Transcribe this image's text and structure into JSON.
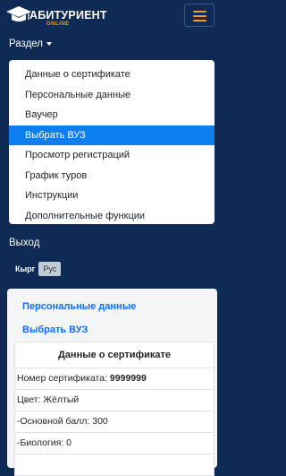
{
  "header": {
    "logo_text": "АБИТУРИЕНТ",
    "logo_sub": "ONLINE"
  },
  "nav": {
    "section_label": "Раздел",
    "menu_items": [
      "Данные о сертификате",
      "Персональные данные",
      "Ваучер",
      "Выбрать ВУЗ",
      "Просмотр регистраций",
      "График туров",
      "Инструкции",
      "Дополнительные функции"
    ],
    "active_item": "Выбрать ВУЗ",
    "logout_label": "Выход",
    "languages": [
      "Кырг",
      "Рус"
    ],
    "selected_language": "Рус"
  },
  "content": {
    "links": [
      "Персональные данные",
      "Выбрать ВУЗ"
    ],
    "card_title": "Данные о сертификате",
    "certificate_label": "Номер сертификата:",
    "certificate_number": "9999999",
    "color_row": "Цвет: Жёлтый",
    "main_score_row": "-Основной балл: 300",
    "biology_row": "-Биология: 0"
  },
  "colors": {
    "background": "#0e2a55",
    "accent": "#f39c1f",
    "active": "#0d7ff0",
    "link": "#0d6efd"
  }
}
